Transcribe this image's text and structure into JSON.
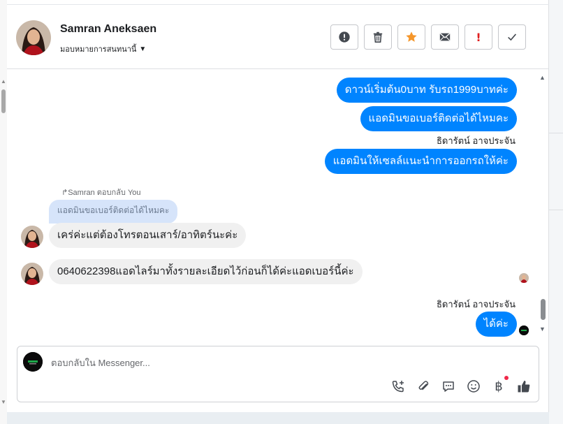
{
  "header": {
    "contact_name": "Samran Aneksaen",
    "assign_label": "มอบหมายการสนทนานี้",
    "actions": [
      {
        "name": "spam",
        "icon": "alert-circle-icon"
      },
      {
        "name": "delete",
        "icon": "trash-icon"
      },
      {
        "name": "star",
        "icon": "star-icon"
      },
      {
        "name": "unread",
        "icon": "envelope-icon"
      },
      {
        "name": "important",
        "icon": "exclamation-icon",
        "label": "!"
      },
      {
        "name": "done",
        "icon": "check-icon"
      }
    ]
  },
  "messages": {
    "out_1": "ดาวน์เริ่มต้น0บาท รับรถ1999บาทค่ะ",
    "out_2": "แอดมินขอเบอร์ติดต่อได้ไหมคะ",
    "sender_1": "ธิดารัตน์ อาจประจัน",
    "out_3": "แอดมินให้เซลล์แนะนำการออกรถให้ค่ะ",
    "reply_meta": "Samran ตอบกลับ You",
    "quoted": "แอดมินขอเบอร์ติดต่อได้ไหมคะ",
    "in_1": "เคร่ค่ะแต่ต้องโทรตอนเสาร์/อาทิตร์นะค่ะ",
    "in_2": "0640622398แอดไลร์มาทั้งรายละเอียดไว้ก่อนก็ได้ค่ะแอดเบอร์นี้ค่ะ",
    "sender_2": "ธิดารัตน์ อาจประจัน",
    "out_4": "ได้ค่ะ"
  },
  "composer": {
    "placeholder": "ตอบกลับใน Messenger...",
    "tools": [
      "add-call-icon",
      "attach-icon",
      "chat-bubble-icon",
      "emoji-icon",
      "baht-icon",
      "thumbs-up-icon"
    ],
    "baht_symbol": "฿"
  },
  "colors": {
    "outgoing": "#0084ff",
    "incoming": "#f0f0f0",
    "quoted": "#d6e4fa",
    "star": "#f5962a",
    "important": "#e02020"
  }
}
